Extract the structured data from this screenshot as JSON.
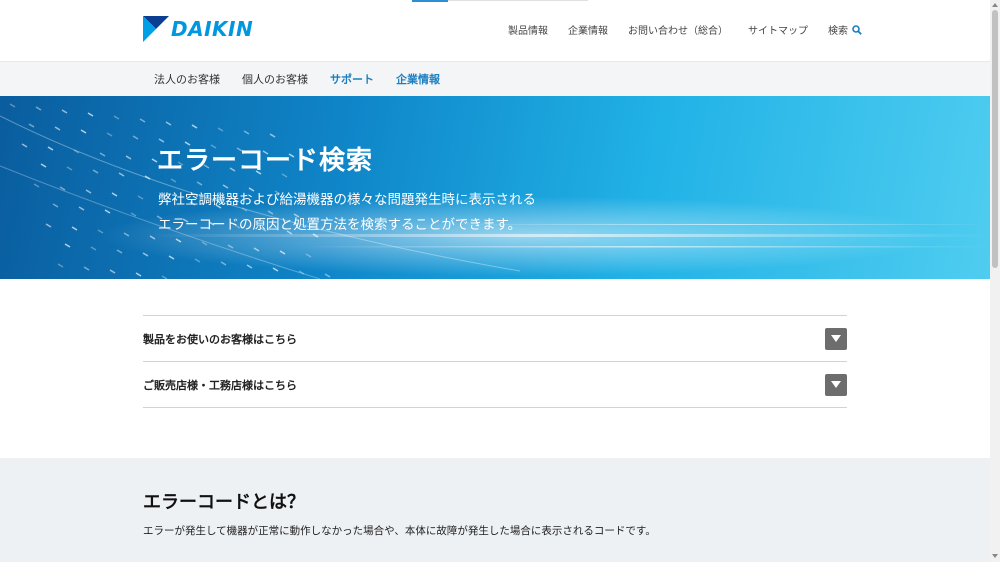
{
  "header": {
    "logo_text": "DAIKIN",
    "nav": [
      "製品情報",
      "企業情報",
      "お問い合わせ（総合）",
      "サイトマップ"
    ],
    "search_label": "検索"
  },
  "subnav": {
    "items": [
      {
        "label": "法人のお客様"
      },
      {
        "label": "個人のお客様"
      },
      {
        "label": "サポート"
      },
      {
        "label": "企業情報"
      }
    ]
  },
  "hero": {
    "title": "エラーコード検索",
    "description_line1": "弊社空調機器および給湯機器の様々な問題発生時に表示される",
    "description_line2": "エラーコードの原因と処置方法を検索することができます。"
  },
  "accordion": [
    {
      "label": "製品をお使いのお客様はこちら"
    },
    {
      "label": "ご販売店様・工務店様はこちら"
    }
  ],
  "info": {
    "title": "エラーコードとは？",
    "text": "エラーが発生して機器が正常に動作しなかった場合や、本体に故障が発生した場合に表示されるコードです。"
  },
  "colors": {
    "brand": "#0097e0",
    "link": "#1d7fc1",
    "hero_start": "#0a5d9e",
    "hero_end": "#4fcdf0"
  }
}
